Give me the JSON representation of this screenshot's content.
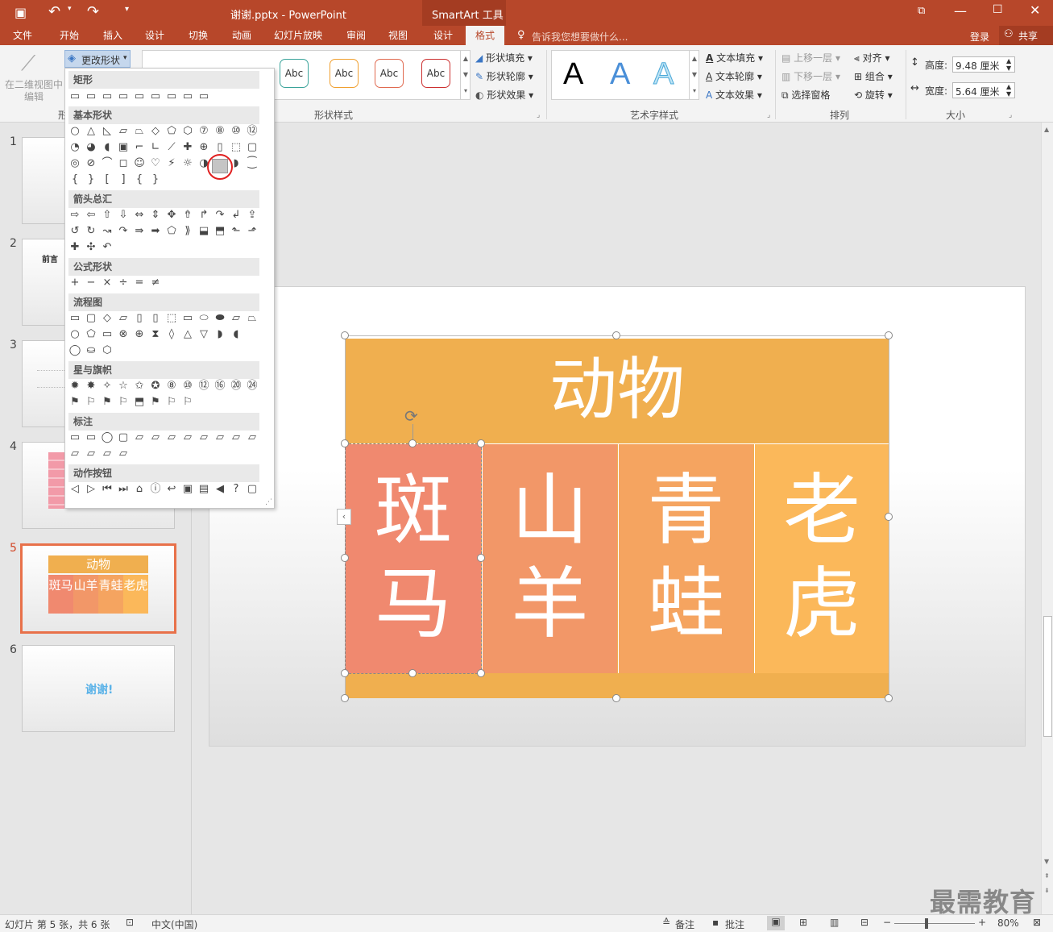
{
  "titlebar": {
    "doc_title": "谢谢.pptx - PowerPoint",
    "tools_label": "SmartArt 工具"
  },
  "tabs": [
    "文件",
    "开始",
    "插入",
    "设计",
    "切换",
    "动画",
    "幻灯片放映",
    "审阅",
    "视图",
    "设计",
    "格式"
  ],
  "tell_me": "告诉我您想要做什么...",
  "account": {
    "login": "登录",
    "share": "共享"
  },
  "ribbon": {
    "edit2d": "在二维视图中编辑",
    "change_shape": "更改形状",
    "shape_style_group": "形状样式",
    "abc": "Abc",
    "shape_fill": "形状填充",
    "shape_outline": "形状轮廓",
    "shape_effects": "形状效果",
    "art_group": "艺术字样式",
    "text_fill": "文本填充",
    "text_outline": "文本轮廓",
    "text_effects": "文本效果",
    "bring_forward": "上移一层",
    "send_backward": "下移一层",
    "selection_pane": "选择窗格",
    "align": "对齐",
    "group": "组合",
    "rotate": "旋转",
    "arrange_group": "排列",
    "height_label": "高度:",
    "height_value": "9.48 厘米",
    "width_label": "宽度:",
    "width_value": "5.64 厘米",
    "size_group": "大小",
    "shape_letter": "形"
  },
  "gallery": {
    "categories": [
      "矩形",
      "基本形状",
      "箭头总汇",
      "公式形状",
      "流程图",
      "星与旗帜",
      "标注",
      "动作按钮"
    ]
  },
  "slides": [
    {
      "num": "1"
    },
    {
      "num": "2",
      "title": "前言"
    },
    {
      "num": "3"
    },
    {
      "num": "4"
    },
    {
      "num": "5",
      "title": "动物",
      "cells": [
        "斑马",
        "山羊",
        "青蛙",
        "老虎"
      ]
    },
    {
      "num": "6",
      "title": "谢谢!"
    }
  ],
  "smartart": {
    "title": "动物",
    "cells": [
      [
        "斑",
        "马"
      ],
      [
        "山",
        "羊"
      ],
      [
        "青",
        "蛙"
      ],
      [
        "老",
        "虎"
      ]
    ]
  },
  "colors": {
    "accent": "#b7472a",
    "header": "#f0af4f",
    "c1": "#f0896f",
    "c2": "#f29768",
    "c3": "#f5a460",
    "c4": "#fbb85a"
  },
  "status": {
    "slide_info": "幻灯片 第 5 张，共 6 张",
    "lang": "中文(中国)",
    "notes": "备注",
    "comments": "批注",
    "zoom": "80%"
  },
  "watermark": "最需教育"
}
